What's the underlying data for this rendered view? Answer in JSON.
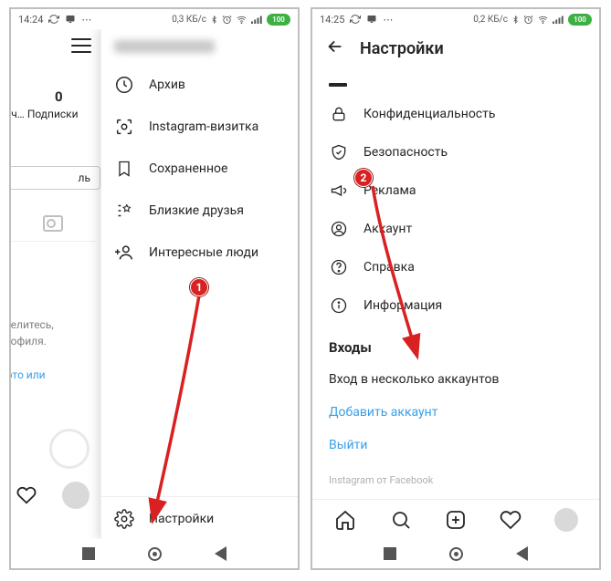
{
  "status": {
    "time_left": "14:24",
    "time_right": "14:25",
    "data_left": "0,3 КБ/с",
    "data_right": "0,2 КБ/с",
    "battery": "100"
  },
  "left_phone": {
    "posts_count": "0",
    "posts_label": "сч…  Подписки",
    "tab_label": "ль",
    "share_line1": "оделитесь,",
    "share_line2": "профиля.",
    "photo_link": "фото или",
    "menu": {
      "archive": "Архив",
      "nametag": "Instagram-визитка",
      "saved": "Сохраненное",
      "close_friends": "Близкие друзья",
      "discover": "Интересные люди",
      "settings": "Настройки"
    }
  },
  "right_phone": {
    "title": "Настройки",
    "items": {
      "privacy": "Конфиденциальность",
      "security": "Безопасность",
      "ads": "Реклама",
      "account": "Аккаунт",
      "help": "Справка",
      "about": "Информация"
    },
    "logins_heading": "Входы",
    "multi_login": "Вход в несколько аккаунтов",
    "add_account": "Добавить аккаунт",
    "logout": "Выйти",
    "footer": "Instagram от Facebook"
  },
  "annotations": {
    "badge1": "1",
    "badge2": "2"
  }
}
